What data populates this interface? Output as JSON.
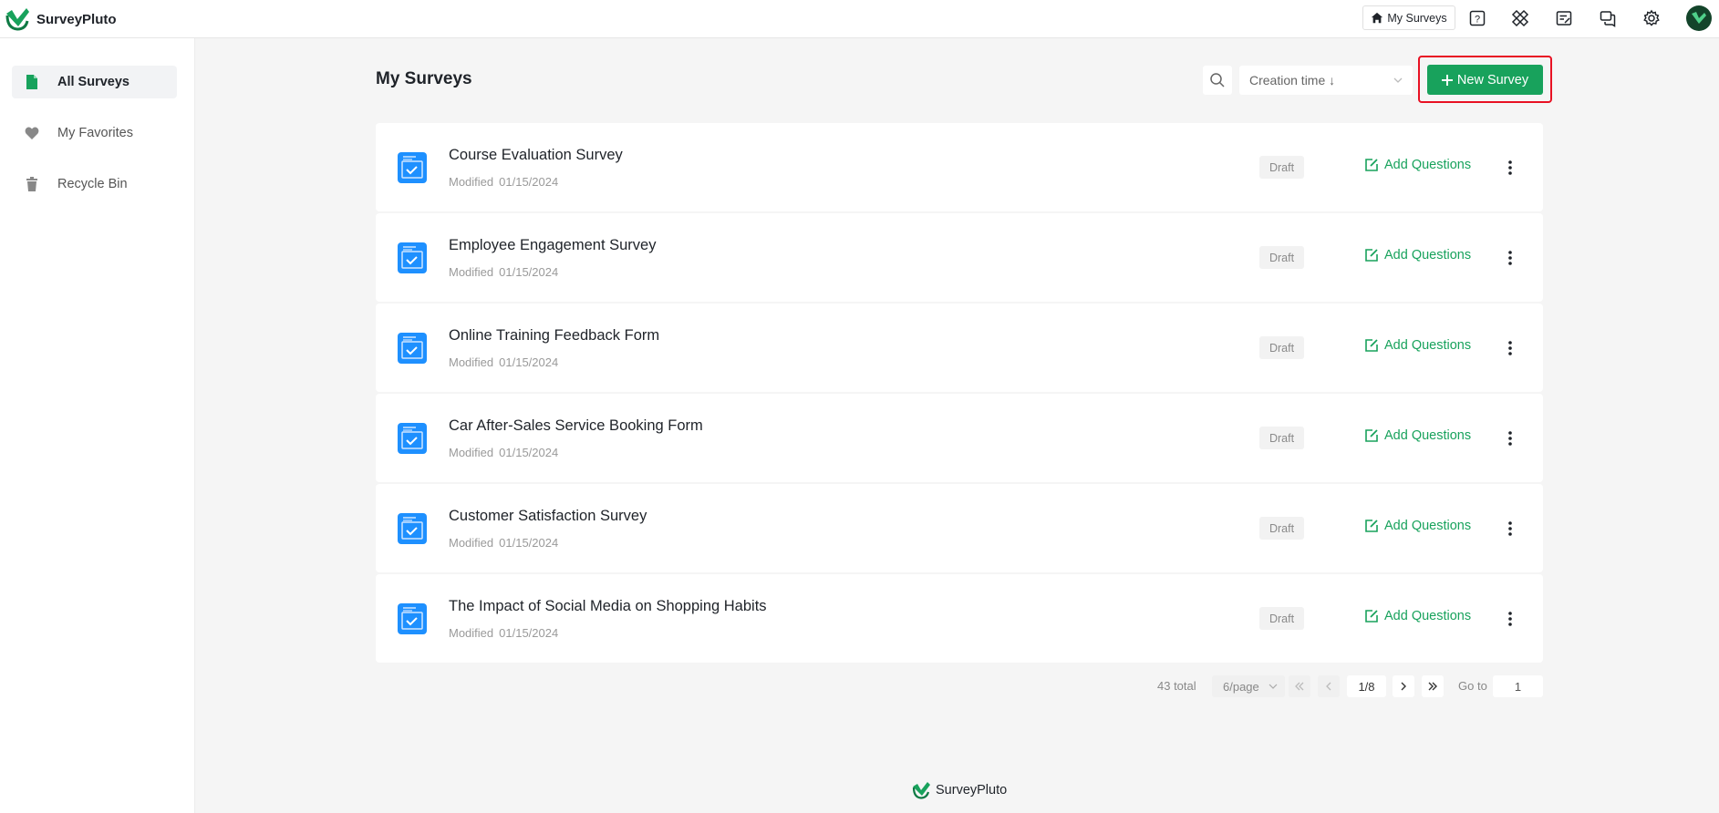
{
  "app": {
    "name": "SurveyPluto"
  },
  "topbar": {
    "home_label": "My Surveys",
    "icons": [
      "help-icon",
      "apps-icon",
      "edit-note-icon",
      "chat-icon",
      "settings-icon"
    ]
  },
  "sidebar": {
    "items": [
      {
        "label": "All Surveys",
        "icon": "file-icon",
        "active": true
      },
      {
        "label": "My Favorites",
        "icon": "heart-icon",
        "active": false
      },
      {
        "label": "Recycle Bin",
        "icon": "trash-icon",
        "active": false
      }
    ]
  },
  "header": {
    "title": "My Surveys",
    "sort_value": "Creation time ↓",
    "new_button": "New Survey"
  },
  "surveys": [
    {
      "title": "Course Evaluation Survey",
      "modified_label": "Modified",
      "date": "01/15/2024",
      "status": "Draft",
      "action": "Add Questions"
    },
    {
      "title": "Employee Engagement Survey",
      "modified_label": "Modified",
      "date": "01/15/2024",
      "status": "Draft",
      "action": "Add Questions"
    },
    {
      "title": "Online Training Feedback Form",
      "modified_label": "Modified",
      "date": "01/15/2024",
      "status": "Draft",
      "action": "Add Questions"
    },
    {
      "title": "Car After-Sales Service Booking Form",
      "modified_label": "Modified",
      "date": "01/15/2024",
      "status": "Draft",
      "action": "Add Questions"
    },
    {
      "title": "Customer Satisfaction Survey",
      "modified_label": "Modified",
      "date": "01/15/2024",
      "status": "Draft",
      "action": "Add Questions"
    },
    {
      "title": "The Impact of Social Media on Shopping Habits",
      "modified_label": "Modified",
      "date": "01/15/2024",
      "status": "Draft",
      "action": "Add Questions"
    }
  ],
  "pagination": {
    "total": "43 total",
    "page_size": "6/page",
    "current": "1/8",
    "goto_label": "Go to",
    "goto_value": "1"
  },
  "footer": {
    "brand": "SurveyPluto"
  },
  "colors": {
    "accent": "#18a25c",
    "highlight": "#e81123",
    "file_icon": "#1e90ff"
  }
}
